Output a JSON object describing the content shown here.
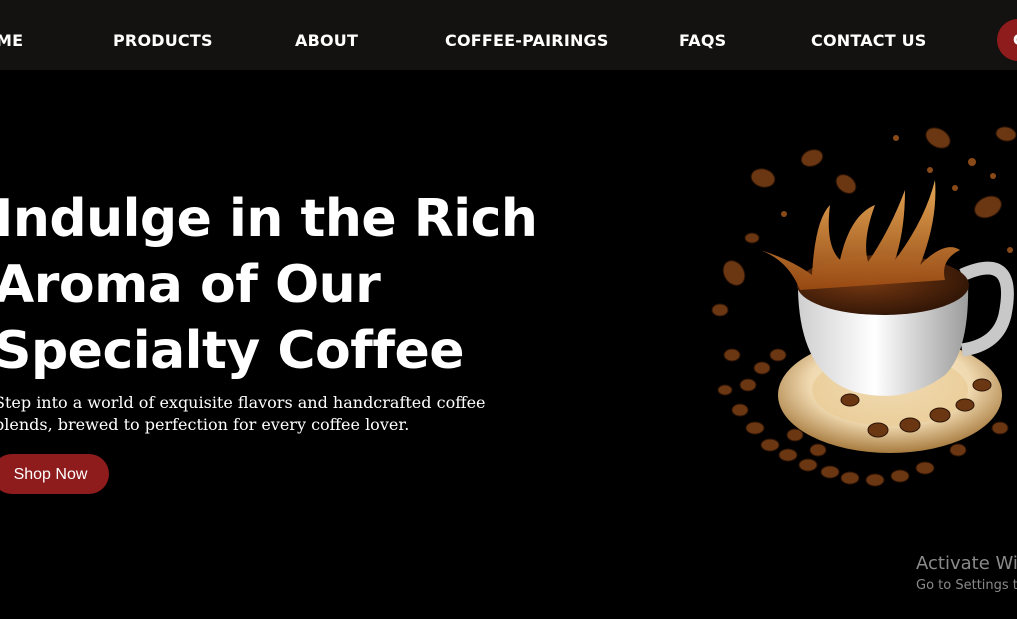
{
  "nav": {
    "links": [
      "ME",
      "PRODUCTS",
      "ABOUT",
      "COFFEE-PAIRINGS",
      "FAQS",
      "CONTACT US"
    ],
    "cta_label": "C"
  },
  "hero": {
    "title_lines": [
      "Indulge in the Rich",
      "Aroma of Our",
      "Specialty Coffee"
    ],
    "subtitle_lines": [
      "Step into a world of exquisite flavors and handcrafted coffee",
      "blends, brewed to perfection for every coffee lover."
    ],
    "button_label": "Shop Now",
    "image_icon": "coffee-cup-splash-image"
  },
  "watermark": {
    "title": "Activate Wi",
    "subtitle": "Go to Settings t"
  },
  "colors": {
    "nav_bg": "#141111",
    "page_bg": "#000000",
    "accent": "#8f1c1c",
    "text": "#ffffff",
    "watermark_text": "#8a8a8a"
  }
}
